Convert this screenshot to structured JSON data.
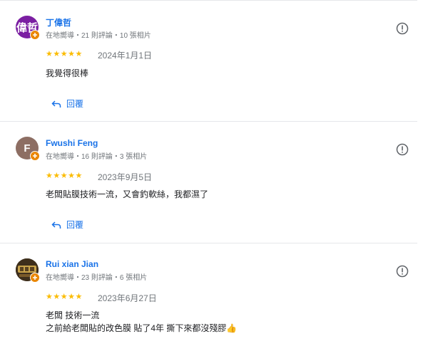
{
  "reviews": [
    {
      "avatar_text": "偉哲",
      "avatar_color": "#7b1fa2",
      "name": "丁偉哲",
      "meta": "在地嚮導・21 則評論・10 張相片",
      "stars": "★★★★★",
      "date": "2024年1月1日",
      "text_lines": [
        "我覺得很棒"
      ],
      "reply_label": "回覆"
    },
    {
      "avatar_text": "F",
      "avatar_color": "#8d6e63",
      "name": "Fwushi Feng",
      "meta": "在地嚮導・16 則評論・3 張相片",
      "stars": "★★★★★",
      "date": "2023年9月5日",
      "text_lines": [
        "老闆貼膜技術一流，又會釣軟絲，我都濕了"
      ],
      "reply_label": "回覆"
    },
    {
      "avatar_text": "",
      "avatar_color": "#3e2f1c",
      "name": "Rui xian Jian",
      "meta": "在地嚮導・23 則評論・6 張相片",
      "stars": "★★★★★",
      "date": "2023年6月27日",
      "text_lines": [
        "老闆 技術一流",
        "之前給老闆貼的改色膜 貼了4年 撕下來都沒殘膠👍"
      ]
    }
  ],
  "colors": {
    "link": "#1a73e8",
    "star": "#fbbc04",
    "guide_badge": "#ea8600"
  },
  "icons": {
    "flag": "report-flag-icon",
    "reply": "reply-arrow-icon",
    "guide": "local-guide-badge-icon"
  }
}
